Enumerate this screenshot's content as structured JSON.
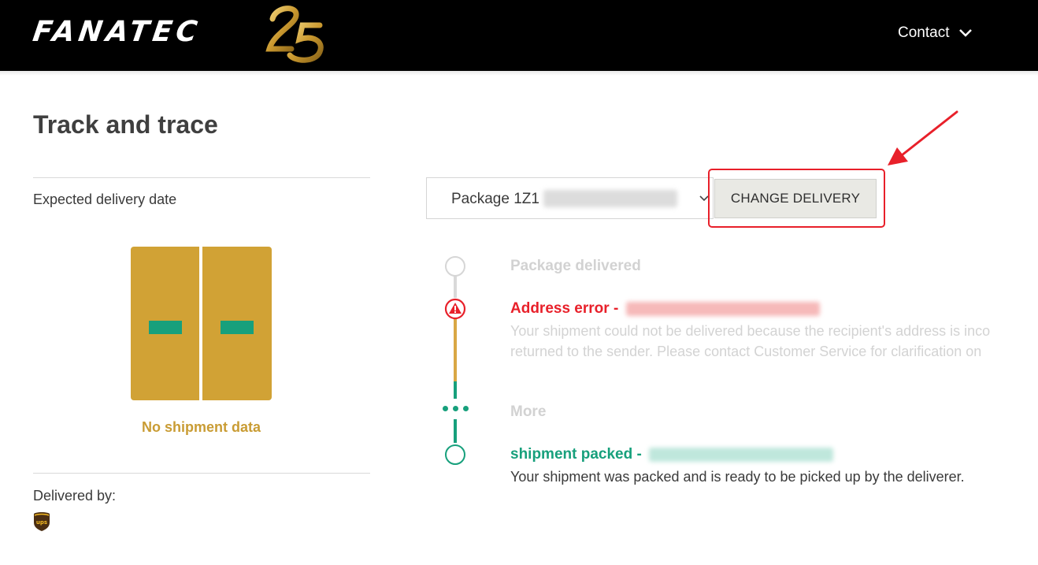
{
  "header": {
    "brand": "FANATEC",
    "anniversary": "25",
    "contact_label": "Contact",
    "contact_icon": "chevron-down-icon"
  },
  "page": {
    "title": "Track and trace"
  },
  "left": {
    "expected_label": "Expected delivery date",
    "no_data_label": "No shipment data",
    "delivered_by_label": "Delivered by:",
    "carrier_icon": "ups-logo-icon",
    "carrier": "ups"
  },
  "package": {
    "select_prefix": "Package 1Z1",
    "change_button": "CHANGE DELIVERY"
  },
  "timeline": {
    "delivered": {
      "title": "Package delivered"
    },
    "error": {
      "title": "Address error - ",
      "desc_line1": "Your shipment could not be delivered because the recipient's address is inco",
      "desc_line2": "returned to the sender. Please contact Customer Service for clarification on"
    },
    "more": {
      "label": "More"
    },
    "packed": {
      "title": "shipment packed - ",
      "desc": "Your shipment was packed and is ready to be picked up by the deliverer."
    }
  },
  "colors": {
    "brand_gold": "#d1a235",
    "green": "#17a07c",
    "error_red": "#e8202a",
    "muted": "#d6d6d6"
  }
}
